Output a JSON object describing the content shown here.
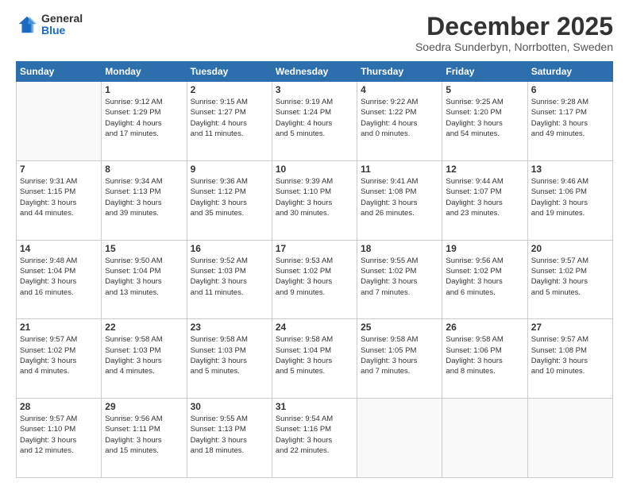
{
  "logo": {
    "general": "General",
    "blue": "Blue"
  },
  "title": "December 2025",
  "subtitle": "Soedra Sunderbyn, Norrbotten, Sweden",
  "days_header": [
    "Sunday",
    "Monday",
    "Tuesday",
    "Wednesday",
    "Thursday",
    "Friday",
    "Saturday"
  ],
  "weeks": [
    [
      {
        "day": "",
        "info": ""
      },
      {
        "day": "1",
        "info": "Sunrise: 9:12 AM\nSunset: 1:29 PM\nDaylight: 4 hours\nand 17 minutes."
      },
      {
        "day": "2",
        "info": "Sunrise: 9:15 AM\nSunset: 1:27 PM\nDaylight: 4 hours\nand 11 minutes."
      },
      {
        "day": "3",
        "info": "Sunrise: 9:19 AM\nSunset: 1:24 PM\nDaylight: 4 hours\nand 5 minutes."
      },
      {
        "day": "4",
        "info": "Sunrise: 9:22 AM\nSunset: 1:22 PM\nDaylight: 4 hours\nand 0 minutes."
      },
      {
        "day": "5",
        "info": "Sunrise: 9:25 AM\nSunset: 1:20 PM\nDaylight: 3 hours\nand 54 minutes."
      },
      {
        "day": "6",
        "info": "Sunrise: 9:28 AM\nSunset: 1:17 PM\nDaylight: 3 hours\nand 49 minutes."
      }
    ],
    [
      {
        "day": "7",
        "info": "Sunrise: 9:31 AM\nSunset: 1:15 PM\nDaylight: 3 hours\nand 44 minutes."
      },
      {
        "day": "8",
        "info": "Sunrise: 9:34 AM\nSunset: 1:13 PM\nDaylight: 3 hours\nand 39 minutes."
      },
      {
        "day": "9",
        "info": "Sunrise: 9:36 AM\nSunset: 1:12 PM\nDaylight: 3 hours\nand 35 minutes."
      },
      {
        "day": "10",
        "info": "Sunrise: 9:39 AM\nSunset: 1:10 PM\nDaylight: 3 hours\nand 30 minutes."
      },
      {
        "day": "11",
        "info": "Sunrise: 9:41 AM\nSunset: 1:08 PM\nDaylight: 3 hours\nand 26 minutes."
      },
      {
        "day": "12",
        "info": "Sunrise: 9:44 AM\nSunset: 1:07 PM\nDaylight: 3 hours\nand 23 minutes."
      },
      {
        "day": "13",
        "info": "Sunrise: 9:46 AM\nSunset: 1:06 PM\nDaylight: 3 hours\nand 19 minutes."
      }
    ],
    [
      {
        "day": "14",
        "info": "Sunrise: 9:48 AM\nSunset: 1:04 PM\nDaylight: 3 hours\nand 16 minutes."
      },
      {
        "day": "15",
        "info": "Sunrise: 9:50 AM\nSunset: 1:04 PM\nDaylight: 3 hours\nand 13 minutes."
      },
      {
        "day": "16",
        "info": "Sunrise: 9:52 AM\nSunset: 1:03 PM\nDaylight: 3 hours\nand 11 minutes."
      },
      {
        "day": "17",
        "info": "Sunrise: 9:53 AM\nSunset: 1:02 PM\nDaylight: 3 hours\nand 9 minutes."
      },
      {
        "day": "18",
        "info": "Sunrise: 9:55 AM\nSunset: 1:02 PM\nDaylight: 3 hours\nand 7 minutes."
      },
      {
        "day": "19",
        "info": "Sunrise: 9:56 AM\nSunset: 1:02 PM\nDaylight: 3 hours\nand 6 minutes."
      },
      {
        "day": "20",
        "info": "Sunrise: 9:57 AM\nSunset: 1:02 PM\nDaylight: 3 hours\nand 5 minutes."
      }
    ],
    [
      {
        "day": "21",
        "info": "Sunrise: 9:57 AM\nSunset: 1:02 PM\nDaylight: 3 hours\nand 4 minutes."
      },
      {
        "day": "22",
        "info": "Sunrise: 9:58 AM\nSunset: 1:03 PM\nDaylight: 3 hours\nand 4 minutes."
      },
      {
        "day": "23",
        "info": "Sunrise: 9:58 AM\nSunset: 1:03 PM\nDaylight: 3 hours\nand 5 minutes."
      },
      {
        "day": "24",
        "info": "Sunrise: 9:58 AM\nSunset: 1:04 PM\nDaylight: 3 hours\nand 5 minutes."
      },
      {
        "day": "25",
        "info": "Sunrise: 9:58 AM\nSunset: 1:05 PM\nDaylight: 3 hours\nand 7 minutes."
      },
      {
        "day": "26",
        "info": "Sunrise: 9:58 AM\nSunset: 1:06 PM\nDaylight: 3 hours\nand 8 minutes."
      },
      {
        "day": "27",
        "info": "Sunrise: 9:57 AM\nSunset: 1:08 PM\nDaylight: 3 hours\nand 10 minutes."
      }
    ],
    [
      {
        "day": "28",
        "info": "Sunrise: 9:57 AM\nSunset: 1:10 PM\nDaylight: 3 hours\nand 12 minutes."
      },
      {
        "day": "29",
        "info": "Sunrise: 9:56 AM\nSunset: 1:11 PM\nDaylight: 3 hours\nand 15 minutes."
      },
      {
        "day": "30",
        "info": "Sunrise: 9:55 AM\nSunset: 1:13 PM\nDaylight: 3 hours\nand 18 minutes."
      },
      {
        "day": "31",
        "info": "Sunrise: 9:54 AM\nSunset: 1:16 PM\nDaylight: 3 hours\nand 22 minutes."
      },
      {
        "day": "",
        "info": ""
      },
      {
        "day": "",
        "info": ""
      },
      {
        "day": "",
        "info": ""
      }
    ]
  ]
}
